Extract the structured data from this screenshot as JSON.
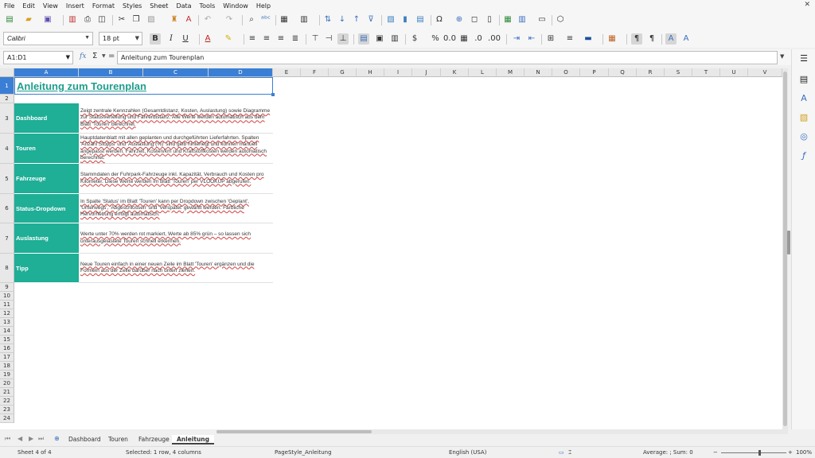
{
  "menu": [
    "File",
    "Edit",
    "View",
    "Insert",
    "Format",
    "Styles",
    "Sheet",
    "Data",
    "Tools",
    "Window",
    "Help"
  ],
  "window_close": "✕",
  "toolbar": {
    "font_name": "Calibri",
    "font_size": "18 pt"
  },
  "formula_bar": {
    "name_box": "A1:D1",
    "fx_label": "fx",
    "sigma": "Σ",
    "equals": "=",
    "content": "Anleitung zum Tourenplan"
  },
  "columns": [
    "A",
    "B",
    "C",
    "D",
    "E",
    "F",
    "G",
    "H",
    "I",
    "J",
    "K",
    "L",
    "M",
    "N",
    "O",
    "P",
    "Q",
    "R",
    "S",
    "T",
    "U",
    "V"
  ],
  "rows": [
    "1",
    "2",
    "3",
    "4",
    "5",
    "6",
    "7",
    "8",
    "9",
    "10",
    "11",
    "12",
    "13",
    "14",
    "15",
    "16",
    "17",
    "18",
    "19",
    "20",
    "21",
    "22",
    "23",
    "24"
  ],
  "sheet": {
    "title": "Anleitung zum Tourenplan",
    "entries": [
      {
        "label": "Dashboard",
        "text": "Zeigt zentrale Kennzahlen (Gesamtdistanz, Kosten, Auslastung) sowie Diagramme zur Statusverteilung und Fahrerdistanz. Alle Werte werden automatisch aus dem Blatt 'Touren' berechnet."
      },
      {
        "label": "Touren",
        "text": "Hauptdatenblatt mit allen geplanten und durchgeführten Lieferfahrten. Spalten 'Anzahl Stopps' und 'Auslastung (%)' sind gelb hinterlegt und können manuell angepasst werden. Fahrzeit, Kosten/km und Kraftstoffkosten werden automatisch berechnet."
      },
      {
        "label": "Fahrzeuge",
        "text": "Stammdaten der Fuhrpark-Fahrzeuge inkl. Kapazität, Verbrauch und Kosten pro Kilometer. Diese Werte werden im Blatt 'Touren' per VLOOKUP abgerufen."
      },
      {
        "label": "Status-Dropdown",
        "text": "In Spalte 'Status' im Blatt 'Touren' kann per Dropdown zwischen 'Geplant', 'Unterwegs', 'Abgeschlossen' und 'Verspätet' gewählt werden. Farbliche Hervorhebung erfolgt automatisch."
      },
      {
        "label": "Auslastung",
        "text": "Werte unter 70% werden rot markiert, Werte ab 85% grün – so lassen sich unterausgelastete Touren schnell erkennen."
      },
      {
        "label": "Tipp",
        "text": "Neue Touren einfach in einer neuen Zeile im Blatt 'Touren' ergänzen und die Formeln aus der Zeile darüber nach unten ziehen."
      }
    ]
  },
  "tabs": [
    "Dashboard",
    "Touren",
    "Fahrzeuge",
    "Anleitung"
  ],
  "active_tab": "Anleitung",
  "status": {
    "sheet": "Sheet 4 of 4",
    "selection": "Selected: 1 row, 4 columns",
    "page_style": "PageStyle_Anleitung",
    "language": "English (USA)",
    "summary": "Average: ; Sum: 0",
    "zoom": "100%"
  },
  "colors": {
    "accent": "#1fae96",
    "title": "#1f9e8c",
    "selection": "#3a7fd5"
  }
}
